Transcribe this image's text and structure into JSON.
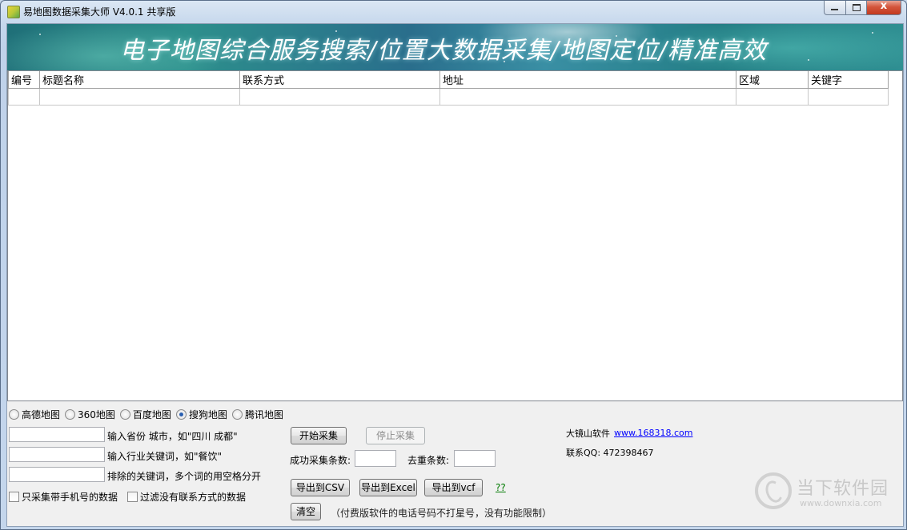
{
  "window": {
    "title": "易地图数据采集大师 V4.0.1 共享版",
    "close_glyph": "x"
  },
  "banner": {
    "text": "电子地图综合服务搜索/位置大数据采集/地图定位/精准高效"
  },
  "table": {
    "columns": [
      "编号",
      "标题名称",
      "联系方式",
      "地址",
      "区域",
      "关键字"
    ],
    "rows": [
      [
        "",
        "",
        "",
        "",
        "",
        ""
      ]
    ]
  },
  "map_sources": {
    "options": [
      "高德地图",
      "360地图",
      "百度地图",
      "搜狗地图",
      "腾讯地图"
    ],
    "selected": "搜狗地图"
  },
  "inputs": {
    "city": {
      "value": "",
      "hint": "输入省份 城市，如\"四川 成都\""
    },
    "keyword": {
      "value": "",
      "hint": "输入行业关键词，如\"餐饮\""
    },
    "exclude": {
      "value": "",
      "hint": "排除的关键词，多个词的用空格分开"
    }
  },
  "checkboxes": {
    "mobile_only": "只采集带手机号的数据",
    "filter_no_contact": "过滤没有联系方式的数据"
  },
  "actions": {
    "start": "开始采集",
    "stop": "停止采集",
    "export_csv": "导出到CSV",
    "export_excel": "导出到Excel",
    "export_vcf": "导出到vcf",
    "clear": "清空",
    "help": "??"
  },
  "stats": {
    "success_label": "成功采集条数:",
    "success_value": "",
    "dedupe_label": "去重条数:",
    "dedupe_value": ""
  },
  "notice": "（付费版软件的电话号码不打星号，没有功能限制）",
  "vendor": {
    "name": "大镜山软件",
    "url": "www.168318.com",
    "qq": "联系QQ: 472398467"
  },
  "watermark": {
    "title": "当下软件园",
    "url": "www.downxia.com"
  }
}
